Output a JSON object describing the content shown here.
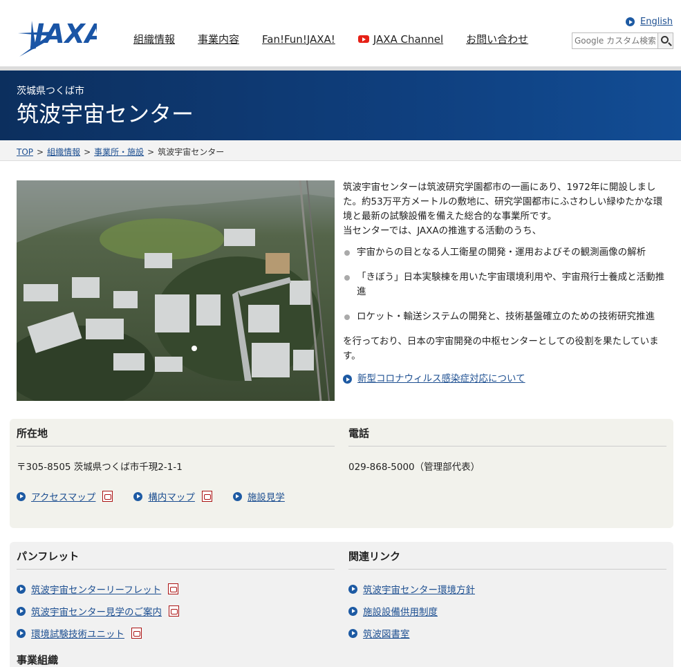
{
  "header": {
    "logo_text": "JAXA",
    "nav": [
      {
        "label": "組織情報"
      },
      {
        "label": "事業内容"
      },
      {
        "label": "Fan!Fun!JAXA!"
      },
      {
        "label": "JAXA Channel"
      },
      {
        "label": "お問い合わせ"
      }
    ],
    "language_link": "English",
    "search_placeholder": "Google カスタム検索"
  },
  "band": {
    "subtitle": "茨城県つくば市",
    "title": "筑波宇宙センター"
  },
  "breadcrumb": {
    "items": [
      "TOP",
      "組織情報",
      "事業所・施設"
    ],
    "current": "筑波宇宙センター",
    "separator": ">"
  },
  "intro": {
    "paragraph1": "筑波宇宙センターは筑波研究学園都市の一画にあり、1972年に開設しました。約53万平方メートルの敷地に、研究学園都市にふさわしい緑ゆたかな環境と最新の試験設備を備えた総合的な事業所です。",
    "paragraph2": "当センターでは、JAXAの推進する活動のうち、",
    "bullets": [
      "宇宙からの目となる人工衛星の開発・運用およびその観測画像の解析",
      "「きぼう」日本実験棟を用いた宇宙環境利用や、宇宙飛行士養成と活動推進",
      "ロケット・輸送システムの開発と、技術基盤確立のための技術研究推進"
    ],
    "paragraph3": "を行っており、日本の宇宙開発の中枢センターとしての役割を果たしています。",
    "covid_link": "新型コロナウィルス感染症対応について"
  },
  "location": {
    "heading": "所在地",
    "address": "〒305-8505 茨城県つくば市千現2-1-1",
    "links": [
      {
        "label": "アクセスマップ",
        "pdf": true
      },
      {
        "label": "構内マップ",
        "pdf": true
      },
      {
        "label": "施設見学",
        "pdf": false
      }
    ]
  },
  "phone": {
    "heading": "電話",
    "number": "029-868-5000（管理部代表）"
  },
  "pamphlet": {
    "heading": "パンフレット",
    "links": [
      {
        "label": "筑波宇宙センターリーフレット",
        "pdf": true
      },
      {
        "label": "筑波宇宙センター見学のご案内",
        "pdf": true
      },
      {
        "label": "環境試験技術ユニット",
        "pdf": true
      }
    ]
  },
  "related": {
    "heading": "関連リンク",
    "links": [
      {
        "label": "筑波宇宙センター環境方針"
      },
      {
        "label": "施設設備供用制度"
      },
      {
        "label": "筑波図書室"
      }
    ]
  },
  "organization": {
    "heading": "事業組織"
  },
  "colors": {
    "band_dark": "#0c2f5e",
    "band_light": "#124d95",
    "link": "#1d4f91",
    "bullet_dot": "#1d5aa3",
    "pdf_red": "#aa1111",
    "youtube_red": "#e62117"
  }
}
